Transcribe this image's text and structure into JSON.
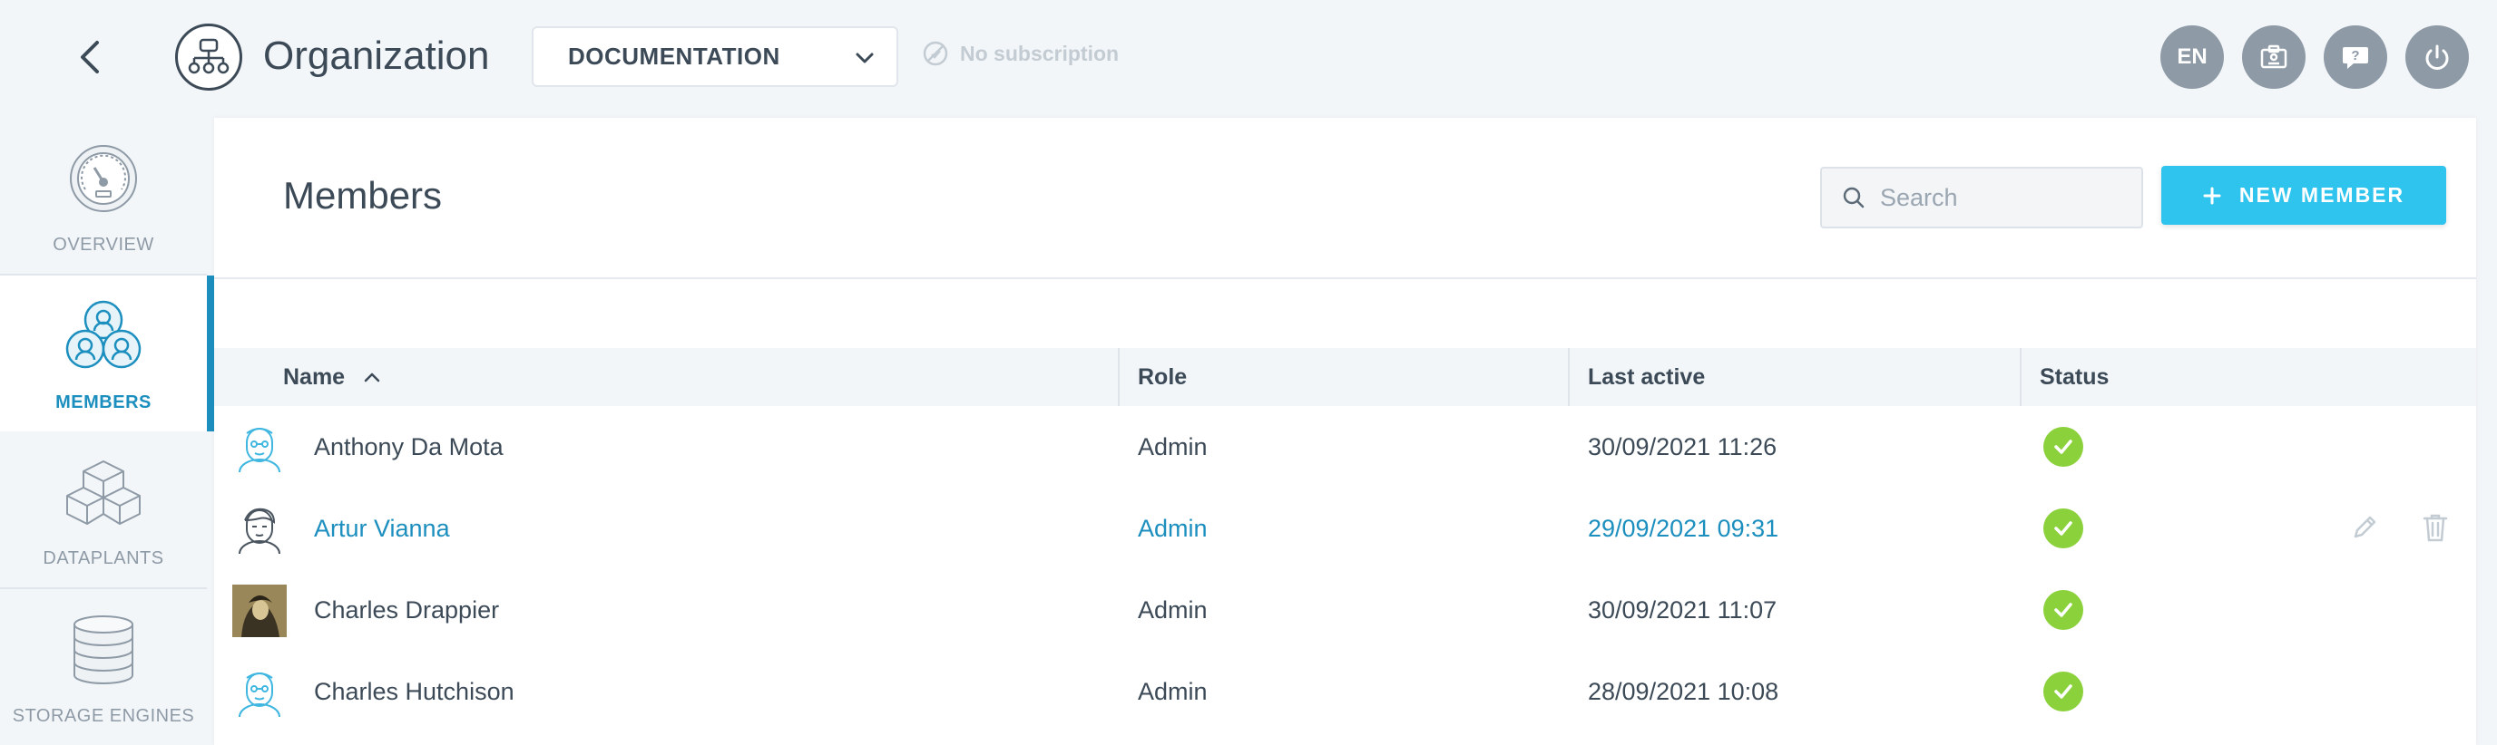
{
  "header": {
    "title": "Organization",
    "project_select": "DOCUMENTATION",
    "subscription_status": "No subscription",
    "language": "EN"
  },
  "sidebar": {
    "items": [
      {
        "label": "OVERVIEW",
        "icon": "gauge-icon",
        "active": false
      },
      {
        "label": "MEMBERS",
        "icon": "members-icon",
        "active": true
      },
      {
        "label": "DATAPLANTS",
        "icon": "cubes-icon",
        "active": false
      },
      {
        "label": "STORAGE ENGINES",
        "icon": "database-icon",
        "active": false
      }
    ]
  },
  "main": {
    "title": "Members",
    "search_placeholder": "Search",
    "new_member_label": "NEW MEMBER",
    "columns": {
      "name": "Name",
      "role": "Role",
      "last_active": "Last active",
      "status": "Status"
    },
    "rows": [
      {
        "name": "Anthony Da Mota",
        "role": "Admin",
        "last_active": "30/09/2021 11:26",
        "status": "active",
        "avatar": "default-avatar-icon"
      },
      {
        "name": "Artur Vianna",
        "role": "Admin",
        "last_active": "29/09/2021 09:31",
        "status": "active",
        "avatar": "sketch-avatar-icon",
        "hovered": true
      },
      {
        "name": "Charles Drappier",
        "role": "Admin",
        "last_active": "30/09/2021 11:07",
        "status": "active",
        "avatar": "photo-avatar"
      },
      {
        "name": "Charles Hutchison",
        "role": "Admin",
        "last_active": "28/09/2021 10:08",
        "status": "active",
        "avatar": "default-avatar-icon"
      }
    ]
  },
  "colors": {
    "accent": "#1c8fbf",
    "primary_button": "#2ec4ee",
    "status_ok": "#8bd13b",
    "header_button": "#8e9aa6"
  }
}
